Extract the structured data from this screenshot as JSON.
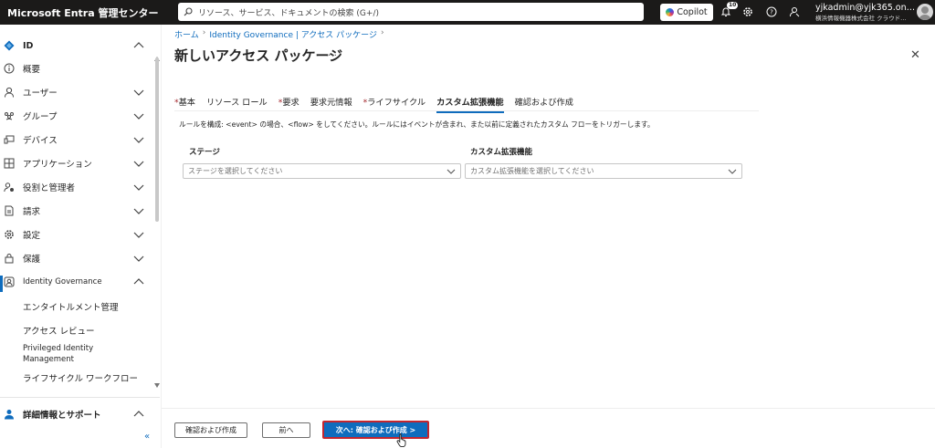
{
  "topbar": {
    "brand": "Microsoft Entra 管理センター",
    "search_placeholder": "リソース、サービス、ドキュメントの検索 (G+/)",
    "copilot_label": "Copilot",
    "notification_count": "10",
    "account_name": "yjkadmin@yjk365.on…",
    "account_org": "横浜情報機器株式会社 クラウド…",
    "icons": [
      "search-icon",
      "copilot-icon",
      "bell-icon",
      "gear-icon",
      "help-icon",
      "feedback-icon",
      "avatar"
    ]
  },
  "sidebar": {
    "items": [
      {
        "label": "ID",
        "icon": "diamond-icon",
        "chevron": "up"
      },
      {
        "label": "概要",
        "icon": "info-icon",
        "chevron": ""
      },
      {
        "label": "ユーザー",
        "icon": "user-icon",
        "chevron": "down"
      },
      {
        "label": "グループ",
        "icon": "group-icon",
        "chevron": "down"
      },
      {
        "label": "デバイス",
        "icon": "devices-icon",
        "chevron": "down"
      },
      {
        "label": "アプリケーション",
        "icon": "apps-icon",
        "chevron": "down"
      },
      {
        "label": "役割と管理者",
        "icon": "roles-icon",
        "chevron": "down"
      },
      {
        "label": "請求",
        "icon": "billing-icon",
        "chevron": "down"
      },
      {
        "label": "設定",
        "icon": "settings-icon",
        "chevron": "down"
      },
      {
        "label": "保護",
        "icon": "lock-icon",
        "chevron": "down"
      },
      {
        "label": "Identity Governance",
        "icon": "governance-icon",
        "chevron": "up"
      }
    ],
    "sub_items": [
      "エンタイトルメント管理",
      "アクセス レビュー",
      "Privileged Identity",
      "Management",
      "ライフサイクル ワークフロー"
    ],
    "footer_item": "詳細情報とサポート",
    "collapse_label": "«"
  },
  "breadcrumb": [
    "ホーム",
    "Identity Governance | アクセス パッケージ"
  ],
  "page_title": "新しいアクセス パッケージ",
  "more_label": "…",
  "close_label": "✕",
  "tabs": [
    {
      "label": "基本",
      "required": true
    },
    {
      "label": "リソース ロール",
      "required": false
    },
    {
      "label": "要求",
      "required": true
    },
    {
      "label": "要求元情報",
      "required": false
    },
    {
      "label": "ライフサイクル",
      "required": true
    },
    {
      "label": "カスタム拡張機能",
      "required": false,
      "selected": true
    },
    {
      "label": "確認および作成",
      "required": false
    }
  ],
  "description": "ルールを構成: <event> の場合、<flow> をしてください。ルールにはイベントが含まれ、また以前に定義されたカスタム フローをトリガーします。",
  "form": {
    "stage_label": "ステージ",
    "stage_placeholder": "ステージを選択してください",
    "extension_label": "カスタム拡張機能",
    "extension_placeholder": "カスタム拡張機能を選択してください"
  },
  "footer": {
    "review_button": "確認および作成",
    "prev_button": "前へ",
    "next_button": "次へ: 確認および作成 >"
  },
  "colors": {
    "accent": "#0f6cbd",
    "topbar": "#1b1a19",
    "highlight_border": "#c4262e",
    "required": "#a4262c"
  }
}
